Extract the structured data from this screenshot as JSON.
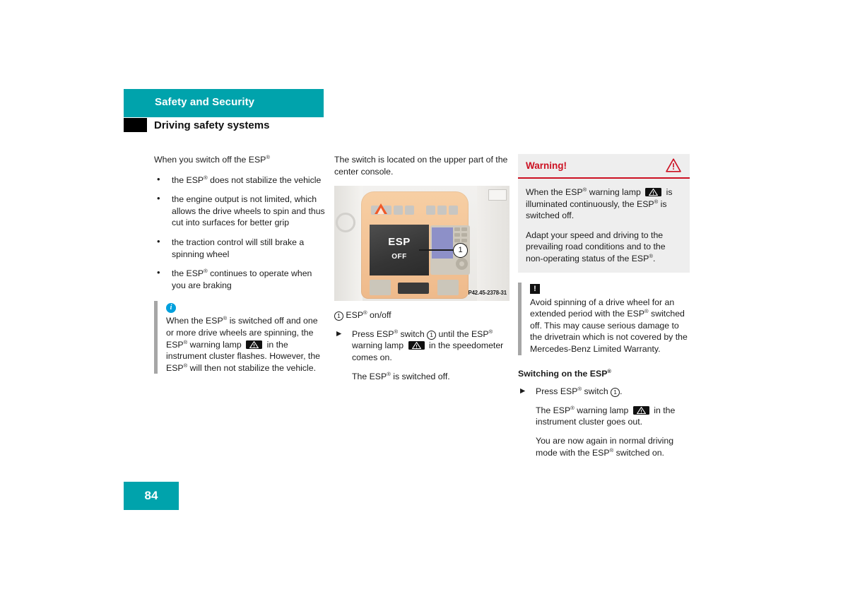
{
  "header": {
    "section_title": "Safety and Security",
    "subsection_title": "Driving safety systems",
    "teal_color": "#00a3ac"
  },
  "left_column": {
    "intro": "When you switch off the ESP",
    "intro_sup": "®",
    "bullets": [
      "the ESP® does not stabilize the vehicle",
      "the engine output is not limited, which allows the drive wheels to spin and thus cut into surfaces for better grip",
      "the traction control will still brake a spinning wheel",
      "the ESP® continues to operate when you are braking"
    ],
    "note": {
      "icon": "info-circle-icon",
      "text_part1": "When the ESP® is switched off and one or more drive wheels are spinning, the ESP® warning lamp",
      "lamp_icon": "esp-warning-lamp-icon",
      "text_part2": "in the instrument cluster flashes. However, the ESP® will then not stabilize the vehicle."
    }
  },
  "middle_column": {
    "intro": "The switch is located on the upper part of the center console.",
    "figure": {
      "name": "center-console-photo",
      "esp_button_line1": "ESP",
      "esp_button_line2": "OFF",
      "callout_number": "1",
      "image_code": "P42.45-2378-31"
    },
    "caption": {
      "number": "1",
      "text": "ESP® on/off"
    },
    "step": {
      "text_part1": "Press ESP® switch",
      "callout": "1",
      "text_part2": "until the ESP® warning lamp",
      "lamp_icon": "esp-warning-lamp-icon",
      "text_part3": "in the speedometer comes on."
    },
    "result": "The ESP® is switched off."
  },
  "right_column": {
    "warning_box": {
      "title": "Warning!",
      "icon": "red-warning-triangle-icon",
      "accent_color": "#cc1122",
      "background_color": "#eeeeee",
      "paragraph1_part1": "When the ESP® warning lamp",
      "paragraph1_lamp": "esp-warning-lamp-icon",
      "paragraph1_part2": "is illuminated continuously, the ESP® is switched off.",
      "paragraph2": "Adapt your speed and driving to the prevailing road conditions and to the non-operating status of the ESP®."
    },
    "note": {
      "icon": "exclamation-box-icon",
      "text": "Avoid spinning of a drive wheel for an extended period with the ESP® switched off. This may cause serious damage to the drivetrain which is not covered by the Mercedes-Benz Limited Warranty."
    },
    "section_heading": "Switching on the ESP®",
    "step": {
      "text_part1": "Press ESP® switch",
      "callout": "1",
      "text_part2": "."
    },
    "result1_part1": "The ESP® warning lamp",
    "result1_lamp": "esp-warning-lamp-icon",
    "result1_part2": "in the instrument cluster goes out.",
    "result2": "You are now again in normal driving mode with the ESP® switched on."
  },
  "footer": {
    "page_number": "84"
  }
}
